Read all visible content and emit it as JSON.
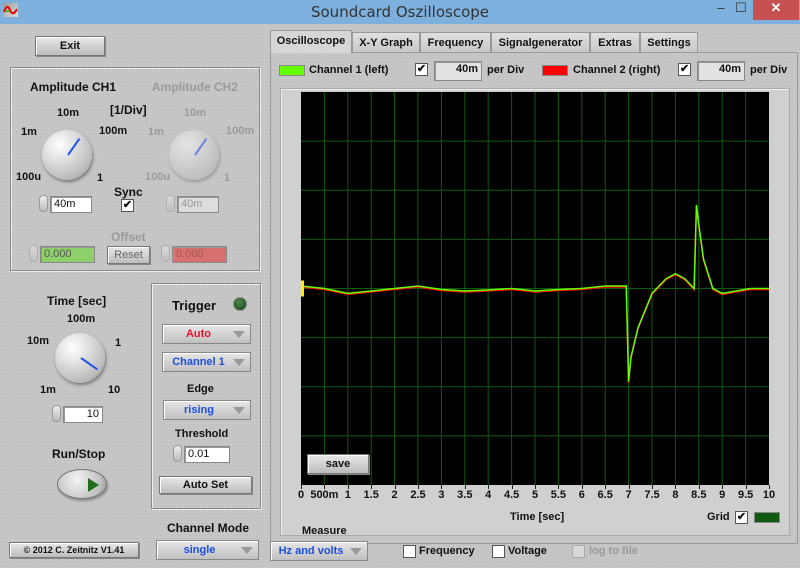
{
  "window": {
    "title": "Soundcard Oszilloscope",
    "minimize_label": "–",
    "maximize_label": "☐",
    "close_label": "✕"
  },
  "left": {
    "exit_label": "Exit",
    "amplitude": {
      "ch1_title": "Amplitude CH1",
      "ch2_title": "Amplitude CH2",
      "unit_label": "[1/Div]",
      "knob_scale": [
        "100u",
        "1m",
        "10m",
        "100m",
        "1"
      ],
      "ch1_value": "40m",
      "ch2_value": "40m",
      "sync_label": "Sync",
      "sync_checked": true,
      "offset_label": "Offset",
      "ch1_offset": "0.000",
      "ch2_offset": "0.000",
      "reset_label": "Reset"
    },
    "time": {
      "title": "Time [sec]",
      "knob_scale": [
        "1m",
        "10m",
        "100m",
        "1",
        "10"
      ],
      "value": "10"
    },
    "run_stop_label": "Run/Stop",
    "copyright": "© 2012  C. Zeitnitz V1.41",
    "trigger": {
      "title": "Trigger",
      "mode": "Auto",
      "source": "Channel 1",
      "edge_label": "Edge",
      "edge": "rising",
      "threshold_label": "Threshold",
      "threshold": "0.01",
      "auto_set_label": "Auto Set"
    },
    "channel_mode_label": "Channel Mode",
    "channel_mode": "single"
  },
  "tabs": [
    {
      "label": "Oscilloscope",
      "active": true
    },
    {
      "label": "X-Y Graph",
      "active": false
    },
    {
      "label": "Frequency",
      "active": false
    },
    {
      "label": "Signalgenerator",
      "active": false
    },
    {
      "label": "Extras",
      "active": false
    },
    {
      "label": "Settings",
      "active": false
    }
  ],
  "scope": {
    "ch1_label": "Channel 1 (left)",
    "ch1_color": "#66ff00",
    "ch1_enabled": true,
    "ch1_per_div": "40m",
    "ch2_label": "Channel 2 (right)",
    "ch2_color": "#ff0000",
    "ch2_enabled": true,
    "ch2_per_div": "40m",
    "per_div_label": "per Div",
    "save_label": "save",
    "xlabel": "Time [sec]",
    "x_ticks": [
      "0",
      "500m",
      "1",
      "1.5",
      "2",
      "2.5",
      "3",
      "3.5",
      "4",
      "4.5",
      "5",
      "5.5",
      "6",
      "6.5",
      "7",
      "7.5",
      "8",
      "8.5",
      "9",
      "9.5",
      "10"
    ],
    "grid_label": "Grid",
    "grid_checked": true,
    "grid_color": "#0f5a0f"
  },
  "measure": {
    "title": "Measure",
    "mode": "Hz and volts",
    "frequency_label": "Frequency",
    "frequency_checked": false,
    "voltage_label": "Voltage",
    "voltage_checked": false,
    "log_label": "log to file",
    "log_checked": false
  },
  "chart_data": {
    "type": "line",
    "title": "",
    "xlabel": "Time [sec]",
    "ylabel": "",
    "xlim": [
      0,
      10
    ],
    "ylim": [
      -4,
      4
    ],
    "y_divisions": 8,
    "x_divisions": 20,
    "grid": true,
    "series": [
      {
        "name": "Channel 1 (left)",
        "color": "#66ff00",
        "x": [
          0,
          0.5,
          1,
          1.5,
          2,
          2.5,
          3,
          3.5,
          4,
          4.5,
          5,
          5.5,
          6,
          6.5,
          6.95,
          7.0,
          7.05,
          7.2,
          7.5,
          7.8,
          8.0,
          8.2,
          8.4,
          8.45,
          8.5,
          8.6,
          8.8,
          9.0,
          9.3,
          9.6,
          10
        ],
        "y": [
          0.05,
          0.0,
          -0.1,
          -0.05,
          0.0,
          0.05,
          -0.02,
          -0.05,
          -0.03,
          0.0,
          -0.05,
          -0.02,
          0.0,
          0.05,
          0.05,
          -1.9,
          -1.4,
          -0.8,
          -0.1,
          0.2,
          0.3,
          0.2,
          0.0,
          1.7,
          1.3,
          0.6,
          0.0,
          -0.1,
          -0.05,
          0.0,
          0.0
        ]
      },
      {
        "name": "Channel 2 (right)",
        "color": "#ff0000",
        "x": [
          0,
          0.5,
          1,
          1.5,
          2,
          2.5,
          3,
          3.5,
          4,
          4.5,
          5,
          5.5,
          6,
          6.5,
          6.95,
          7.0,
          7.05,
          7.2,
          7.5,
          7.8,
          8.0,
          8.2,
          8.4,
          8.45,
          8.5,
          8.6,
          8.8,
          9.0,
          9.3,
          9.6,
          10
        ],
        "y": [
          0.05,
          0.0,
          -0.1,
          -0.05,
          0.0,
          0.05,
          -0.02,
          -0.05,
          -0.03,
          0.0,
          -0.05,
          -0.02,
          0.0,
          0.05,
          0.05,
          -1.9,
          -1.4,
          -0.8,
          -0.1,
          0.2,
          0.3,
          0.2,
          0.0,
          1.7,
          1.3,
          0.6,
          0.0,
          -0.1,
          -0.05,
          0.0,
          0.0
        ]
      }
    ]
  }
}
